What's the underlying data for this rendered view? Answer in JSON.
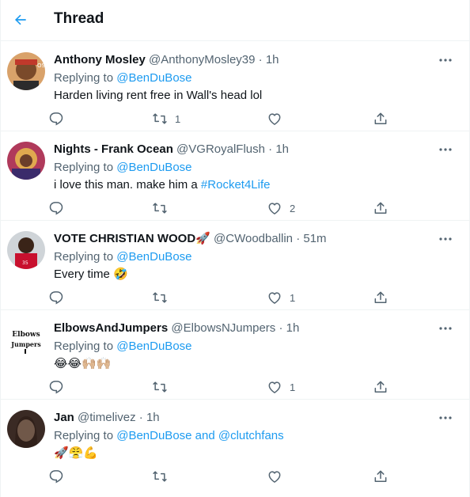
{
  "header": {
    "title": "Thread"
  },
  "tweets": [
    {
      "name": "Anthony Mosley",
      "handle": "@AnthonyMosley39",
      "time": "1h",
      "replying_prefix": "Replying to",
      "replying_to": "@BenDuBose",
      "text_plain": "Harden living rent free in Wall's head lol",
      "retweets": "1",
      "likes": ""
    },
    {
      "name": "Nights - Frank Ocean",
      "handle": "@VGRoyalFlush",
      "time": "1h",
      "replying_prefix": "Replying to",
      "replying_to": "@BenDuBose",
      "text_plain": "i love this man. make him a",
      "text_link": "#Rocket4Life",
      "retweets": "",
      "likes": "2"
    },
    {
      "name": "VOTE CHRISTIAN WOOD",
      "name_emoji": "🚀",
      "handle": "@CWoodballin",
      "time": "51m",
      "replying_prefix": "Replying to",
      "replying_to": "@BenDuBose",
      "text_plain": "Every time",
      "text_emoji": "🤣",
      "retweets": "",
      "likes": "1"
    },
    {
      "name": "ElbowsAndJumpers",
      "handle": "@ElbowsNJumpers",
      "time": "1h",
      "replying_prefix": "Replying to",
      "replying_to": "@BenDuBose",
      "text_emoji": "😂😂🙌🏼🙌🏼",
      "avatar_text_1": "Elbows",
      "avatar_text_2": "Jumpers",
      "retweets": "",
      "likes": "1"
    },
    {
      "name": "Jan",
      "handle": "@timelivez",
      "time": "1h",
      "replying_prefix": "Replying to",
      "replying_to": "@BenDuBose and @clutchfans",
      "text_emoji": "🚀😤💪",
      "retweets": "",
      "likes": ""
    }
  ],
  "separator": "·",
  "colors": {
    "accent": "#1d9bf0",
    "muted": "#536471",
    "text": "#0f1419",
    "border": "#eff3f4"
  },
  "icons": [
    "back-arrow-icon",
    "more-icon",
    "reply-icon",
    "retweet-icon",
    "like-icon",
    "share-icon"
  ]
}
